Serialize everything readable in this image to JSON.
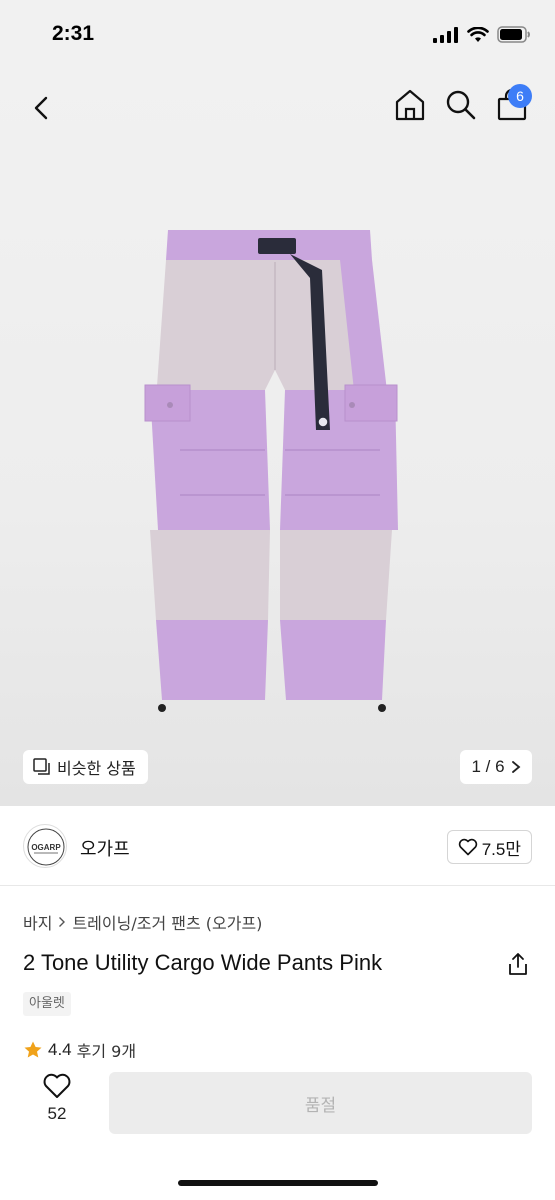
{
  "status": {
    "time": "2:31"
  },
  "header": {
    "cart_count": "6"
  },
  "gallery": {
    "similar_label": "비슷한 상품",
    "counter": "1 / 6"
  },
  "brand": {
    "name": "오가프",
    "logo_text": "OGARP",
    "like_count": "7.5만"
  },
  "breadcrumb": {
    "category": "바지",
    "subcategory": "트레이닝/조거 팬츠 (오가프)"
  },
  "product": {
    "title": "2 Tone Utility Cargo Wide Pants Pink",
    "tag": "아울렛",
    "rating": "4.4",
    "reviews": "후기 9개"
  },
  "bottom": {
    "wish_count": "52",
    "action_label": "품절"
  },
  "colors": {
    "accent": "#3d7df7",
    "star": "#f0a21a",
    "pants_light": "#d9cfd6",
    "pants_lilac": "#c9a6dd"
  }
}
